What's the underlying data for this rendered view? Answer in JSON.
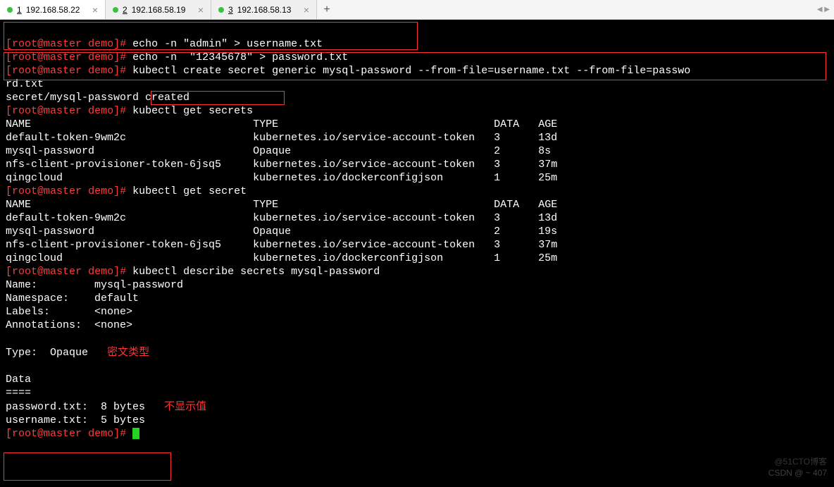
{
  "tabs": [
    {
      "num": "1",
      "label": "192.168.58.22",
      "active": true,
      "close": "×"
    },
    {
      "num": "2",
      "label": "192.168.58.19",
      "active": false,
      "close": "×"
    },
    {
      "num": "3",
      "label": "192.168.58.13",
      "active": false,
      "close": "×"
    }
  ],
  "tab_add": "+",
  "prompt": {
    "user": "root",
    "host": "master",
    "dir": "demo",
    "hash": "#"
  },
  "cmds": {
    "echo_user": "echo -n \"admin\" > username.txt",
    "echo_pass": "echo -n  \"12345678\" > password.txt",
    "create_secret": "kubectl create secret generic mysql-password --from-file=username.txt --from-file=passwo",
    "create_secret_wrap": "rd.txt",
    "create_output": "secret/mysql-password created",
    "get_secrets": "kubectl get secrets",
    "get_secret": "kubectl get secret",
    "describe": "kubectl describe secrets mysql-password"
  },
  "table1": {
    "headers": {
      "name": "NAME",
      "type": "TYPE",
      "data": "DATA",
      "age": "AGE"
    },
    "rows": [
      {
        "name": "default-token-9wm2c",
        "type": "kubernetes.io/service-account-token",
        "data": "3",
        "age": "13d"
      },
      {
        "name": "mysql-password",
        "type": "Opaque",
        "data": "2",
        "age": "8s"
      },
      {
        "name": "nfs-client-provisioner-token-6jsq5",
        "type": "kubernetes.io/service-account-token",
        "data": "3",
        "age": "37m"
      },
      {
        "name": "qingcloud",
        "type": "kubernetes.io/dockerconfigjson",
        "data": "1",
        "age": "25m"
      }
    ]
  },
  "table2": {
    "headers": {
      "name": "NAME",
      "type": "TYPE",
      "data": "DATA",
      "age": "AGE"
    },
    "rows": [
      {
        "name": "default-token-9wm2c",
        "type": "kubernetes.io/service-account-token",
        "data": "3",
        "age": "13d"
      },
      {
        "name": "mysql-password",
        "type": "Opaque",
        "data": "2",
        "age": "19s"
      },
      {
        "name": "nfs-client-provisioner-token-6jsq5",
        "type": "kubernetes.io/service-account-token",
        "data": "3",
        "age": "37m"
      },
      {
        "name": "qingcloud",
        "type": "kubernetes.io/dockerconfigjson",
        "data": "1",
        "age": "25m"
      }
    ]
  },
  "describe": {
    "name_label": "Name:",
    "name_value": "mysql-password",
    "ns_label": "Namespace:",
    "ns_value": "default",
    "labels_label": "Labels:",
    "labels_value": "<none>",
    "annot_label": "Annotations:",
    "annot_value": "<none>",
    "type_label": "Type:",
    "type_value": "Opaque",
    "data_header": "Data",
    "data_sep": "====",
    "pwd_key": "password.txt:",
    "pwd_val": "8 bytes",
    "user_key": "username.txt:",
    "user_val": "5 bytes"
  },
  "annotations": {
    "cipher_type": "密文类型",
    "no_show_value": "不显示值"
  },
  "watermark2": "@51CTO博客",
  "watermark": "CSDN @ ~ 407"
}
